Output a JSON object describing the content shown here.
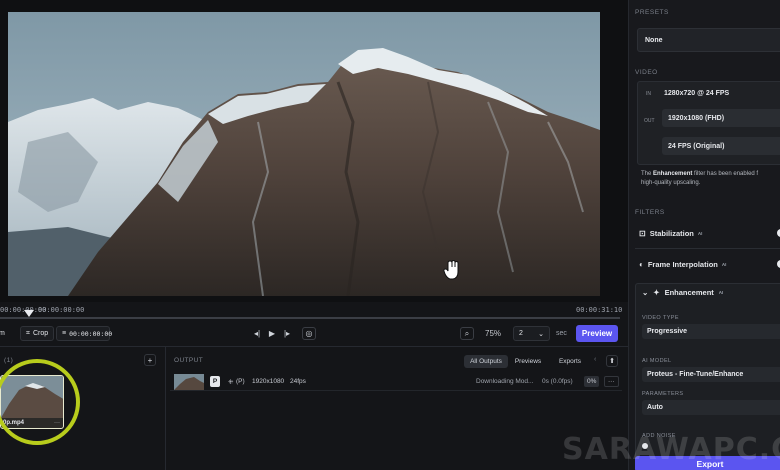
{
  "timeline": {
    "start_time": "00:00:00:00",
    "current_time": "00:00:00:00",
    "end_time": "00:00:31:10",
    "playhead_position": 0.0
  },
  "toolbar": {
    "trim_label": "m",
    "crop_label": "Crop",
    "timecode": "00:00:00:00",
    "zoom": "75%",
    "speed_value": "2",
    "speed_unit": "sec",
    "preview_label": "Preview"
  },
  "inputs": {
    "count": "(1)",
    "add": "+",
    "file_name": "0p.mp4"
  },
  "outputs": {
    "header": "OUTPUT",
    "tabs": [
      "All Outputs",
      "Previews",
      "Exports"
    ],
    "row": {
      "badge": "P",
      "mode": "(P)",
      "resolution": "1920x1080",
      "fps": "24fps",
      "status": "Downloading Mod...",
      "time": "0s (0.0fps)",
      "percent": "0%",
      "more": "···"
    }
  },
  "panel": {
    "presets_title": "PRESETS",
    "preset_value": "None",
    "video_title": "VIDEO",
    "in_label": "IN",
    "in_value": "1280x720 @ 24 FPS",
    "out_label": "OUT",
    "out_resolution": "1920x1080 (FHD)",
    "out_fps": "24 FPS (Original)",
    "note_pre": "The ",
    "note_bold": "Enhancement",
    "note_post": " filter has been enabled f",
    "note_line2": "high-quality upscaling.",
    "filters_title": "FILTERS",
    "stabilization": "Stabilization",
    "frame_interp": "Frame Interpolation",
    "ai_sup": "AI",
    "enhancement": "Enhancement",
    "video_type_label": "VIDEO TYPE",
    "video_type": "Progressive",
    "ai_model_label": "AI MODEL",
    "ai_model": "Proteus - Fine-Tune/Enhance",
    "parameters_label": "PARAMETERS",
    "parameters": "Auto",
    "add_noise_label": "ADD NOISE",
    "export_label": "Export"
  },
  "watermark": "SARAWAPC.CO",
  "colors": {
    "accent": "#5b55f0",
    "highlight_ring": "#b8cc1c",
    "background": "#141518"
  }
}
